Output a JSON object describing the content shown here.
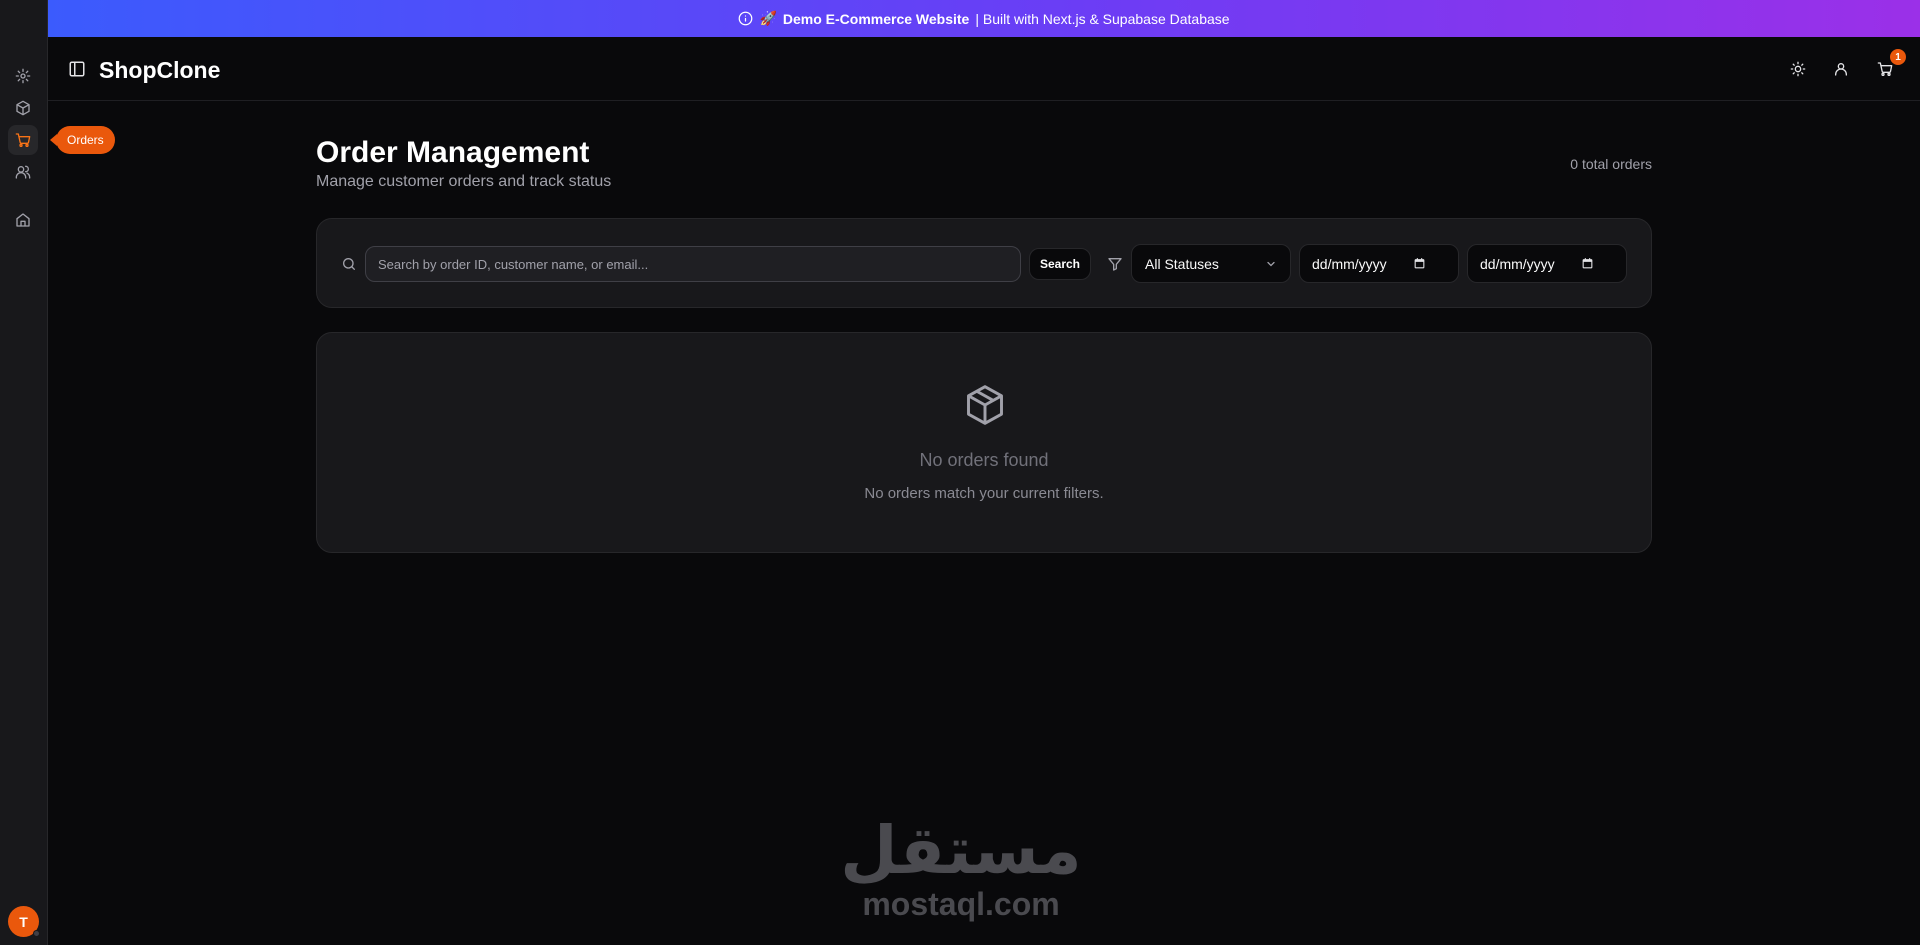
{
  "banner": {
    "emoji": "🚀",
    "strong": "Demo E-Commerce Website",
    "rest": "| Built with Next.js & Supabase Database"
  },
  "rail": {
    "items": [
      "gear-icon",
      "package-icon",
      "cart-icon",
      "users-icon",
      "home-icon"
    ],
    "active_tooltip": "Orders",
    "avatar_initial": "T"
  },
  "header": {
    "logo": "ShopClone",
    "cart_count": "1"
  },
  "page": {
    "title": "Order Management",
    "subtitle": "Manage customer orders and track status",
    "total_orders": "0 total orders"
  },
  "filters": {
    "search_placeholder": "Search by order ID, customer name, or email...",
    "search_button": "Search",
    "status_value": "All Statuses",
    "date_from_placeholder": "dd/mm/yyyy",
    "date_to_placeholder": "dd/mm/yyyy"
  },
  "empty_state": {
    "title": "No orders found",
    "description": "No orders match your current filters."
  },
  "watermark": {
    "arabic": "مستقل",
    "latin": "mostaql.com"
  },
  "colors": {
    "accent": "#ea580c",
    "background": "#09090b",
    "card": "#18181b",
    "banner_start": "#3b5bfd",
    "banner_end": "#9b30e8"
  }
}
